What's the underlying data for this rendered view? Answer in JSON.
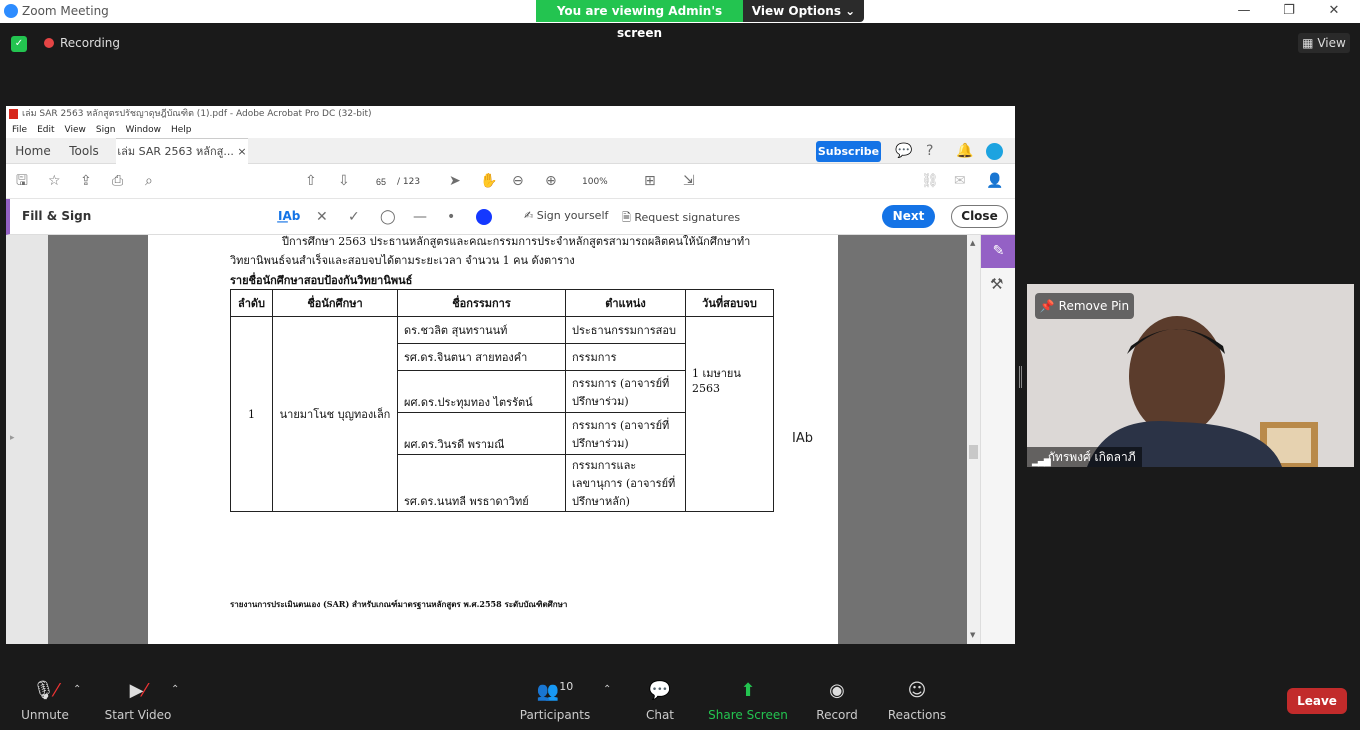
{
  "zoom": {
    "window_title": "Zoom Meeting",
    "banner": "You are viewing Admin's screen",
    "view_options": "View Options ⌄",
    "recording": "Recording",
    "view_label": "View",
    "win_min": "—",
    "win_max": "❐",
    "win_close": "✕"
  },
  "acrobat": {
    "title": "เล่ม SAR 2563 หลักสูตรปรัชญาดุษฎีบัณฑิต (1).pdf - Adobe Acrobat Pro DC (32-bit)",
    "menu": [
      "File",
      "Edit",
      "View",
      "Sign",
      "Window",
      "Help"
    ],
    "tab_home": "Home",
    "tab_tools": "Tools",
    "tab_doc": "เล่ม SAR 2563 หลักสู...",
    "subscribe": "Subscribe",
    "page_current": "65",
    "page_total": "/ 123",
    "zoom": "100%",
    "fill_sign_title": "Fill & Sign",
    "sign_yourself": "Sign yourself",
    "request_signatures": "Request signatures",
    "next": "Next",
    "close": "Close",
    "accent": "#9461c5",
    "blue": "#1473e6"
  },
  "document": {
    "line1": "ปีการศึกษา 2563 ประธานหลักสูตรและคณะกรรมการประจำหลักสูตรสามารถผลิตคนให้นักศึกษาทำ",
    "line2": "วิทยานิพนธ์จนสำเร็จและสอบจบได้ตามระยะเวลา จำนวน 1 คน ดังตาราง",
    "heading": "รายชื่อนักศึกษาสอบป้องกันวิทยานิพนธ์",
    "table": {
      "headers": [
        "ลำดับ",
        "ชื่อนักศึกษา",
        "ชื่อกรรมการ",
        "ตำแหน่ง",
        "วันที่สอบจบ"
      ],
      "order": "1",
      "student": "นายมาโนช บุญทองเล็ก",
      "date": "1 เมษายน 2563",
      "members": [
        {
          "name": "ดร.ชวลิต   สุนทรานนท์",
          "role": "ประธานกรรมการสอบ"
        },
        {
          "name": "รศ.ดร.จินตนา        สายทองคำ",
          "role": "กรรมการ"
        },
        {
          "name": "ผศ.ดร.ประทุมทอง ไตรรัตน์",
          "role": "กรรมการ (อาจารย์ที่ปรึกษาร่วม)"
        },
        {
          "name": "ผศ.ดร.วินรดี   พรามณี",
          "role": "กรรมการ (อาจารย์ที่ปรึกษาร่วม)"
        },
        {
          "name": "รศ.ดร.นนทลี  พรธาดาวิทย์",
          "role": "กรรมการและเลขานุการ (อาจารย์ที่ปรึกษาหลัก)"
        }
      ]
    },
    "cursor_text": "Ab",
    "footer": "รายงานการประเมินตนเอง (SAR) สำหรับเกณฑ์มาตรฐานหลักสูตร พ.ศ.2558 ระดับบัณฑิตศึกษา"
  },
  "video": {
    "remove_pin": "Remove Pin",
    "participant_name": "ภัทรพงศ์ เกิดลาภี"
  },
  "toolbar": {
    "unmute": "Unmute",
    "start_video": "Start Video",
    "participants": "Participants",
    "participants_count": "10",
    "chat": "Chat",
    "share_screen": "Share Screen",
    "record": "Record",
    "reactions": "Reactions",
    "leave": "Leave"
  }
}
